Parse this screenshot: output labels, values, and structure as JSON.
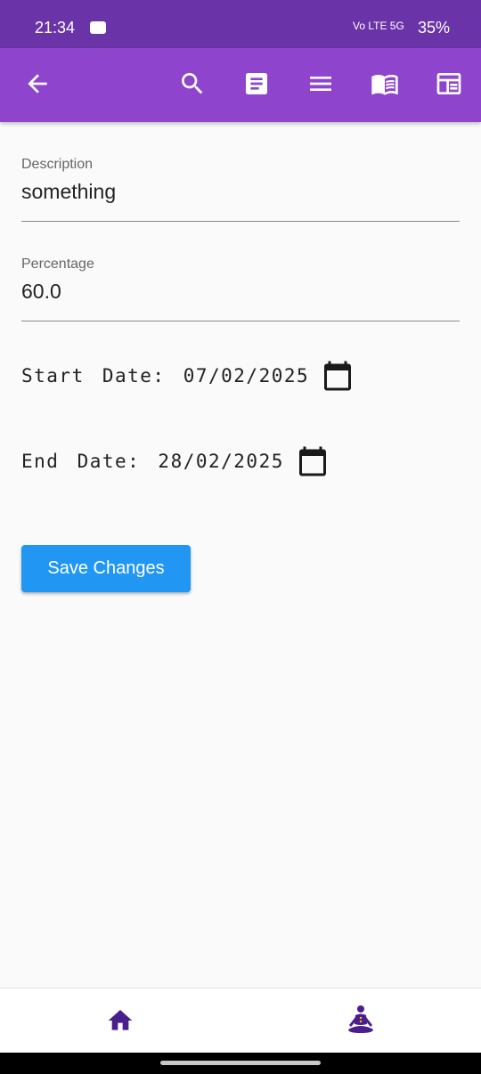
{
  "status_bar": {
    "time": "21:34",
    "network": "Vo LTE 5G",
    "battery": "35%"
  },
  "app_bar": {
    "actions": [
      "back-arrow-icon",
      "search-icon",
      "article-icon",
      "menu-lines-icon",
      "book-open-icon",
      "calendar-grid-icon"
    ]
  },
  "form": {
    "description": {
      "label": "Description",
      "value": "something"
    },
    "percentage": {
      "label": "Percentage",
      "value": "60.0"
    },
    "start_date": {
      "text": "Start Date: 07/02/2025"
    },
    "end_date": {
      "text": "End Date: 28/02/2025"
    },
    "save_label": "Save Changes"
  },
  "bottom_nav": {
    "items": [
      "home-icon",
      "meditation-icon"
    ]
  },
  "colors": {
    "status_bar": "#6a34a8",
    "app_bar": "#8e44cc",
    "save_button": "#2196f3",
    "nav_icon": "#4a1e8c"
  }
}
